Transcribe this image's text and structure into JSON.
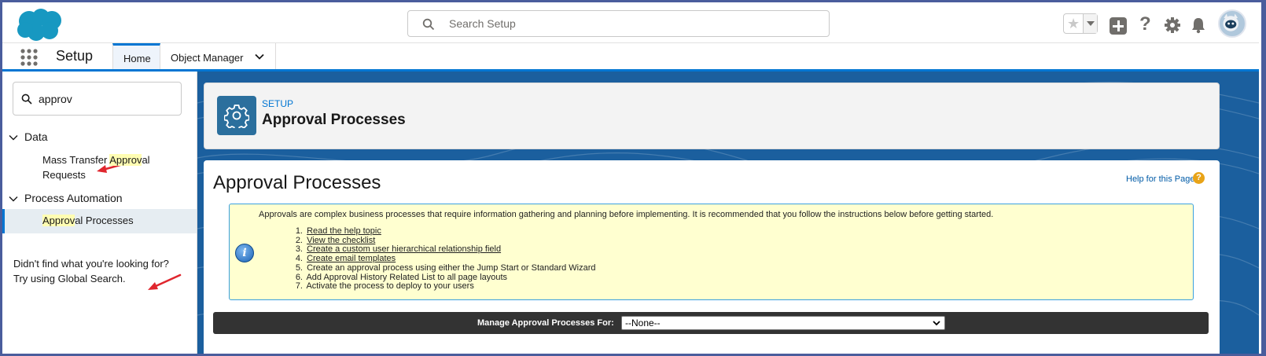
{
  "header": {
    "search_placeholder": "Search Setup",
    "icons": [
      "salesforce-logo",
      "search-icon",
      "favorites-star-icon",
      "add-icon",
      "help-icon",
      "gear-icon",
      "bell-icon",
      "avatar"
    ]
  },
  "nav": {
    "app_name": "Setup",
    "tabs": [
      {
        "label": "Home",
        "active": true
      },
      {
        "label": "Object Manager",
        "active": false
      }
    ]
  },
  "sidebar": {
    "quickfind_value": "approv",
    "sections": [
      {
        "label": "Data",
        "items": [
          {
            "pre": "Mass Transfer ",
            "hl": "Approv",
            "post": "al Requests"
          }
        ]
      },
      {
        "label": "Process Automation",
        "items": [
          {
            "pre": "",
            "hl": "Approv",
            "post": "al Processes"
          }
        ]
      }
    ],
    "not_found_line1": "Didn't find what you're looking for?",
    "not_found_line2": "Try using Global Search."
  },
  "page_header": {
    "eyebrow": "SETUP",
    "title": "Approval Processes"
  },
  "content": {
    "title": "Approval Processes",
    "help_link": "Help for this Page",
    "intro": "Approvals are complex business processes that require information gathering and planning before implementing. It is recommended that you follow the instructions below before getting started.",
    "steps": [
      {
        "n": "1.",
        "text": "Read the help topic",
        "link": true
      },
      {
        "n": "2.",
        "text": "View the checklist",
        "link": true
      },
      {
        "n": "3.",
        "text": "Create a custom user hierarchical relationship field",
        "link": true
      },
      {
        "n": "4.",
        "text": "Create email templates",
        "link": true
      },
      {
        "n": "5.",
        "text": "Create an approval process using either the Jump Start or Standard Wizard",
        "link": false
      },
      {
        "n": "6.",
        "text": "Add Approval History Related List to all page layouts",
        "link": false
      },
      {
        "n": "7.",
        "text": "Activate the process to deploy to your users",
        "link": false
      }
    ],
    "manage_label": "Manage Approval Processes For:",
    "manage_selected": "--None--"
  },
  "colors": {
    "brand_blue": "#0176d3",
    "main_bg": "#1b5f9e",
    "info_bg": "#ffffd0",
    "annotation_red": "#e0262e"
  }
}
